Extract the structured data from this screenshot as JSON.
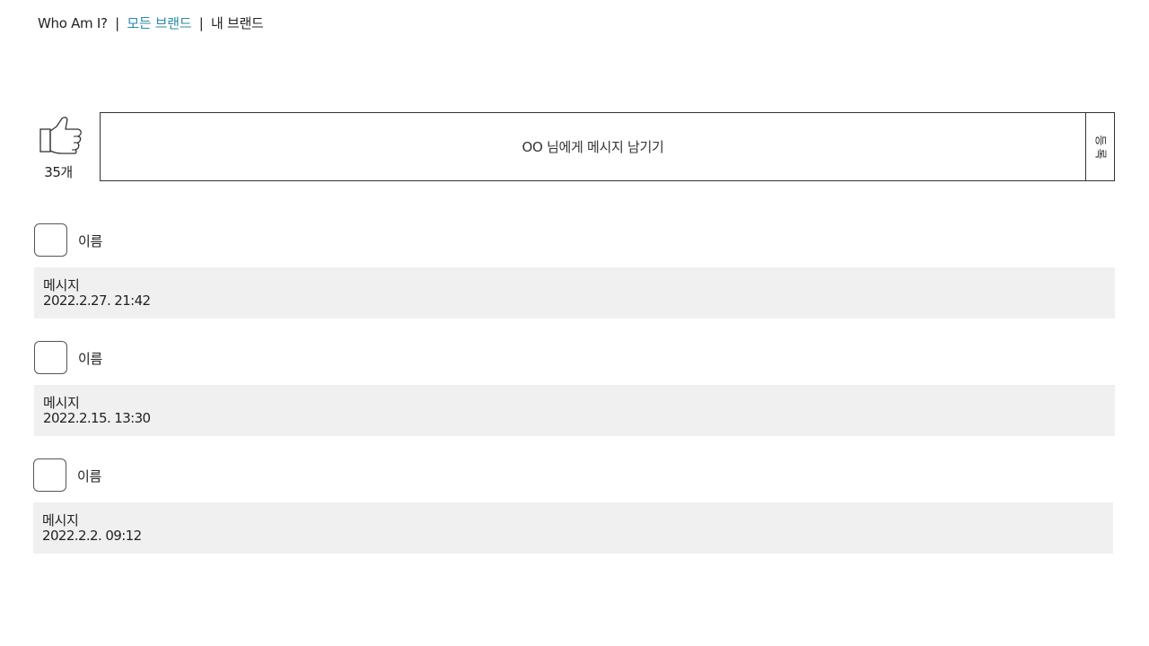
{
  "nav": {
    "site_name": "Who Am I?",
    "separator": "|",
    "all_brands": "모든 브랜드",
    "my_brand": "내 브랜드",
    "active_color": "#2a8aa8"
  },
  "like": {
    "icon": "thumbs-up-icon",
    "count_label": "35개"
  },
  "message_input": {
    "placeholder": "OO 님에게 메시지 남기기",
    "submit_label": "등록",
    "submit_chars": [
      "등",
      "록"
    ]
  },
  "comments": [
    {
      "name": "이름",
      "message": "메시지",
      "timestamp": "2022.2.27. 21:42"
    },
    {
      "name": "이름",
      "message": "메시지",
      "timestamp": "2022.2.15. 13:30"
    },
    {
      "name": "이름",
      "message": "메시지",
      "timestamp": "2022.2.2. 09:12"
    }
  ]
}
